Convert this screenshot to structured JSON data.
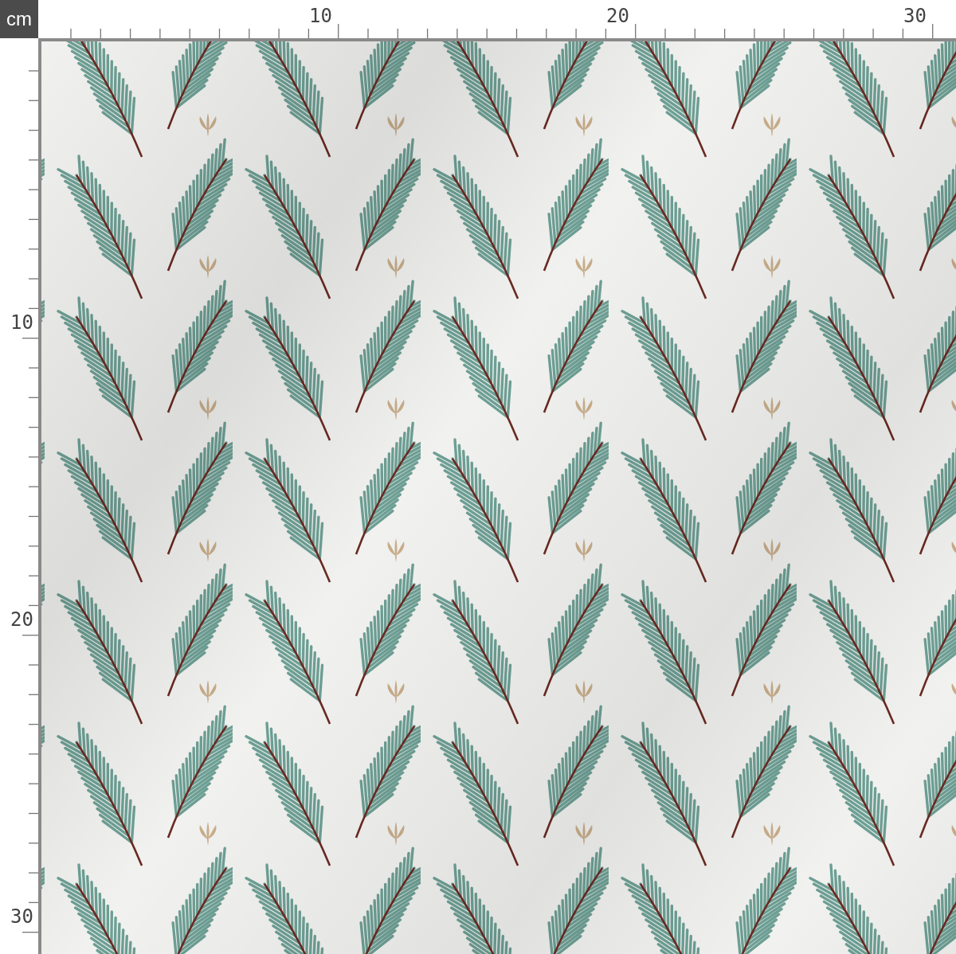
{
  "corner_unit": "cm",
  "top_ruler": {
    "labels": [
      "10",
      "20",
      "30"
    ]
  },
  "left_ruler": {
    "labels": [
      "10",
      "20",
      "30"
    ]
  }
}
